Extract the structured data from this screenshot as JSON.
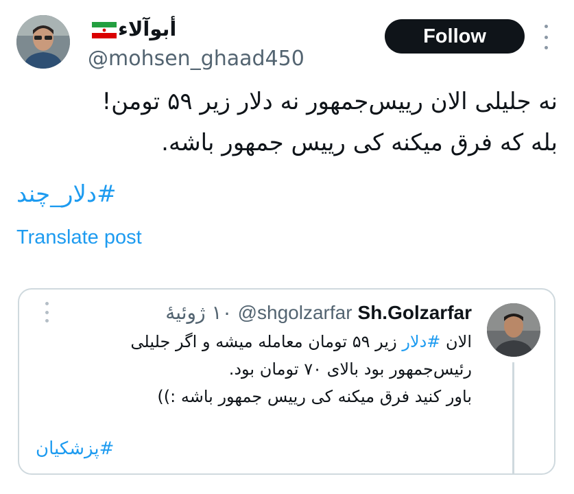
{
  "author": {
    "display_name": "أبوآلاء",
    "handle": "@mohsen_ghaad450",
    "flag_icon": "iran-flag-icon"
  },
  "follow_label": "Follow",
  "tweet": {
    "lines": [
      "نه جلیلی الان رییس‌جمهور نه دلار زیر ۵۹ تومن!",
      "بله که فرق میکنه کی رییس جمهور باشه."
    ],
    "hashtag": "#دلار_چند",
    "translate_label": "Translate post"
  },
  "quote": {
    "name": "Sh.Golzarfar",
    "handle": "@shgolzarfar",
    "date": "۱۰ ژوئیهٔ",
    "line1_prefix": "الان ",
    "line1_hashtag": "#دلار",
    "line1_suffix": " زیر ۵۹ تومان معامله میشه و اگر جلیلی",
    "line2": "رئیس‌جمهور بود بالای ۷۰ تومان بود.",
    "line3": "باور کنید فرق میکنه کی رییس جمهور باشه :))",
    "hashtag": "#پزشکیان"
  },
  "colors": {
    "accent": "#1d9bf0",
    "text": "#0f1419",
    "muted": "#536471",
    "border": "#cfd9de"
  }
}
